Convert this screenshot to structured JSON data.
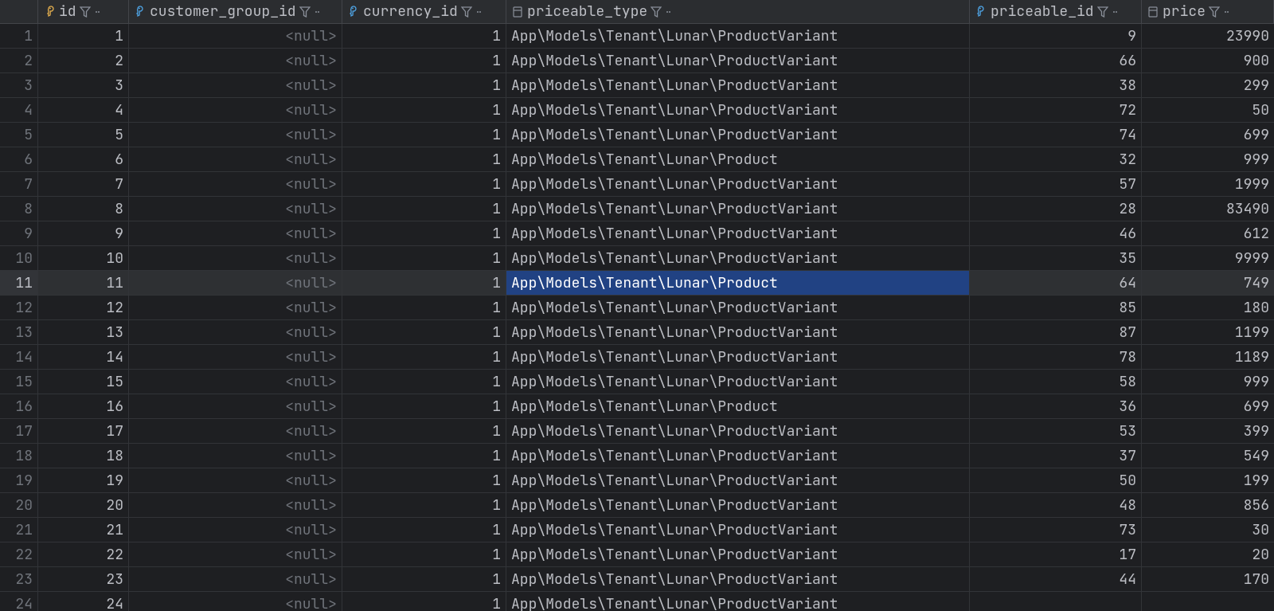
{
  "columns": [
    {
      "key": "id",
      "label": "id",
      "pk": true,
      "sortable": true
    },
    {
      "key": "customer_group_id",
      "label": "customer_group_id",
      "pk": false,
      "sortable": true
    },
    {
      "key": "currency_id",
      "label": "currency_id",
      "pk": false,
      "sortable": true
    },
    {
      "key": "priceable_type",
      "label": "priceable_type",
      "pk": false,
      "sortable": true
    },
    {
      "key": "priceable_id",
      "label": "priceable_id",
      "pk": false,
      "sortable": true
    },
    {
      "key": "price",
      "label": "price",
      "pk": false,
      "sortable": true
    }
  ],
  "null_text": "<null>",
  "rows": [
    {
      "n": 1,
      "id": "1",
      "customer_group_id": null,
      "currency_id": "1",
      "priceable_type": "App\\Models\\Tenant\\Lunar\\ProductVariant",
      "priceable_id": "9",
      "price": "23990"
    },
    {
      "n": 2,
      "id": "2",
      "customer_group_id": null,
      "currency_id": "1",
      "priceable_type": "App\\Models\\Tenant\\Lunar\\ProductVariant",
      "priceable_id": "66",
      "price": "900"
    },
    {
      "n": 3,
      "id": "3",
      "customer_group_id": null,
      "currency_id": "1",
      "priceable_type": "App\\Models\\Tenant\\Lunar\\ProductVariant",
      "priceable_id": "38",
      "price": "299"
    },
    {
      "n": 4,
      "id": "4",
      "customer_group_id": null,
      "currency_id": "1",
      "priceable_type": "App\\Models\\Tenant\\Lunar\\ProductVariant",
      "priceable_id": "72",
      "price": "50"
    },
    {
      "n": 5,
      "id": "5",
      "customer_group_id": null,
      "currency_id": "1",
      "priceable_type": "App\\Models\\Tenant\\Lunar\\ProductVariant",
      "priceable_id": "74",
      "price": "699"
    },
    {
      "n": 6,
      "id": "6",
      "customer_group_id": null,
      "currency_id": "1",
      "priceable_type": "App\\Models\\Tenant\\Lunar\\Product",
      "priceable_id": "32",
      "price": "999"
    },
    {
      "n": 7,
      "id": "7",
      "customer_group_id": null,
      "currency_id": "1",
      "priceable_type": "App\\Models\\Tenant\\Lunar\\ProductVariant",
      "priceable_id": "57",
      "price": "1999"
    },
    {
      "n": 8,
      "id": "8",
      "customer_group_id": null,
      "currency_id": "1",
      "priceable_type": "App\\Models\\Tenant\\Lunar\\ProductVariant",
      "priceable_id": "28",
      "price": "83490"
    },
    {
      "n": 9,
      "id": "9",
      "customer_group_id": null,
      "currency_id": "1",
      "priceable_type": "App\\Models\\Tenant\\Lunar\\ProductVariant",
      "priceable_id": "46",
      "price": "612"
    },
    {
      "n": 10,
      "id": "10",
      "customer_group_id": null,
      "currency_id": "1",
      "priceable_type": "App\\Models\\Tenant\\Lunar\\ProductVariant",
      "priceable_id": "35",
      "price": "9999"
    },
    {
      "n": 11,
      "id": "11",
      "customer_group_id": null,
      "currency_id": "1",
      "priceable_type": "App\\Models\\Tenant\\Lunar\\Product",
      "priceable_id": "64",
      "price": "749"
    },
    {
      "n": 12,
      "id": "12",
      "customer_group_id": null,
      "currency_id": "1",
      "priceable_type": "App\\Models\\Tenant\\Lunar\\ProductVariant",
      "priceable_id": "85",
      "price": "180"
    },
    {
      "n": 13,
      "id": "13",
      "customer_group_id": null,
      "currency_id": "1",
      "priceable_type": "App\\Models\\Tenant\\Lunar\\ProductVariant",
      "priceable_id": "87",
      "price": "1199"
    },
    {
      "n": 14,
      "id": "14",
      "customer_group_id": null,
      "currency_id": "1",
      "priceable_type": "App\\Models\\Tenant\\Lunar\\ProductVariant",
      "priceable_id": "78",
      "price": "1189"
    },
    {
      "n": 15,
      "id": "15",
      "customer_group_id": null,
      "currency_id": "1",
      "priceable_type": "App\\Models\\Tenant\\Lunar\\ProductVariant",
      "priceable_id": "58",
      "price": "999"
    },
    {
      "n": 16,
      "id": "16",
      "customer_group_id": null,
      "currency_id": "1",
      "priceable_type": "App\\Models\\Tenant\\Lunar\\Product",
      "priceable_id": "36",
      "price": "699"
    },
    {
      "n": 17,
      "id": "17",
      "customer_group_id": null,
      "currency_id": "1",
      "priceable_type": "App\\Models\\Tenant\\Lunar\\ProductVariant",
      "priceable_id": "53",
      "price": "399"
    },
    {
      "n": 18,
      "id": "18",
      "customer_group_id": null,
      "currency_id": "1",
      "priceable_type": "App\\Models\\Tenant\\Lunar\\ProductVariant",
      "priceable_id": "37",
      "price": "549"
    },
    {
      "n": 19,
      "id": "19",
      "customer_group_id": null,
      "currency_id": "1",
      "priceable_type": "App\\Models\\Tenant\\Lunar\\ProductVariant",
      "priceable_id": "50",
      "price": "199"
    },
    {
      "n": 20,
      "id": "20",
      "customer_group_id": null,
      "currency_id": "1",
      "priceable_type": "App\\Models\\Tenant\\Lunar\\ProductVariant",
      "priceable_id": "48",
      "price": "856"
    },
    {
      "n": 21,
      "id": "21",
      "customer_group_id": null,
      "currency_id": "1",
      "priceable_type": "App\\Models\\Tenant\\Lunar\\ProductVariant",
      "priceable_id": "73",
      "price": "30"
    },
    {
      "n": 22,
      "id": "22",
      "customer_group_id": null,
      "currency_id": "1",
      "priceable_type": "App\\Models\\Tenant\\Lunar\\ProductVariant",
      "priceable_id": "17",
      "price": "20"
    },
    {
      "n": 23,
      "id": "23",
      "customer_group_id": null,
      "currency_id": "1",
      "priceable_type": "App\\Models\\Tenant\\Lunar\\ProductVariant",
      "priceable_id": "44",
      "price": "170"
    },
    {
      "n": 24,
      "id": "24",
      "customer_group_id": null,
      "currency_id": "1",
      "priceable_type": "App\\Models\\Tenant\\Lunar\\ProductVariant",
      "priceable_id": "",
      "price": ""
    }
  ],
  "selected_row": 11,
  "selected_col": "priceable_type"
}
